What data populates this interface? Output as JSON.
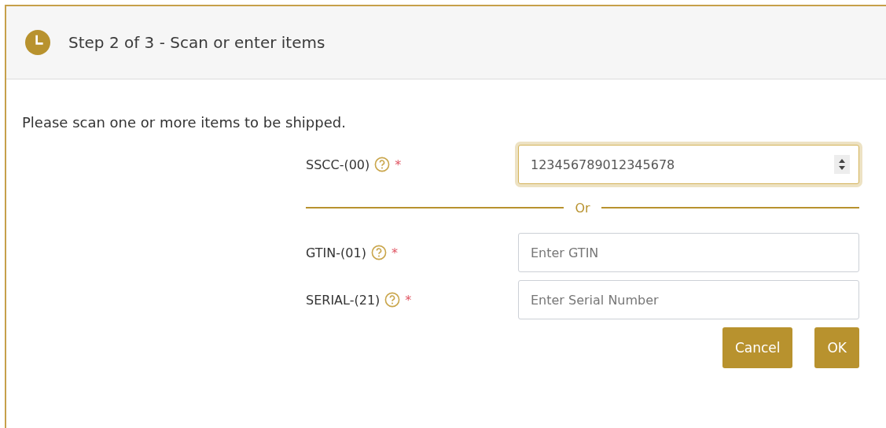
{
  "dialog": {
    "title": "Step 2 of 3 - Scan or enter items"
  },
  "instruction": "Please scan one or more items to be shipped.",
  "fields": [
    {
      "label": "SSCC-(00)",
      "required_mark": "*",
      "kind": "number",
      "value": "123456789012345678",
      "focused": true
    },
    {
      "kind": "divider",
      "label": "Or"
    },
    {
      "label": "GTIN-(01)",
      "required_mark": "*",
      "kind": "text",
      "placeholder": "Enter GTIN",
      "focused": false
    },
    {
      "label": "SERIAL-(21)",
      "required_mark": "*",
      "kind": "text",
      "placeholder": "Enter Serial Number",
      "focused": false
    }
  ],
  "buttons": [
    "Cancel",
    "OK"
  ]
}
